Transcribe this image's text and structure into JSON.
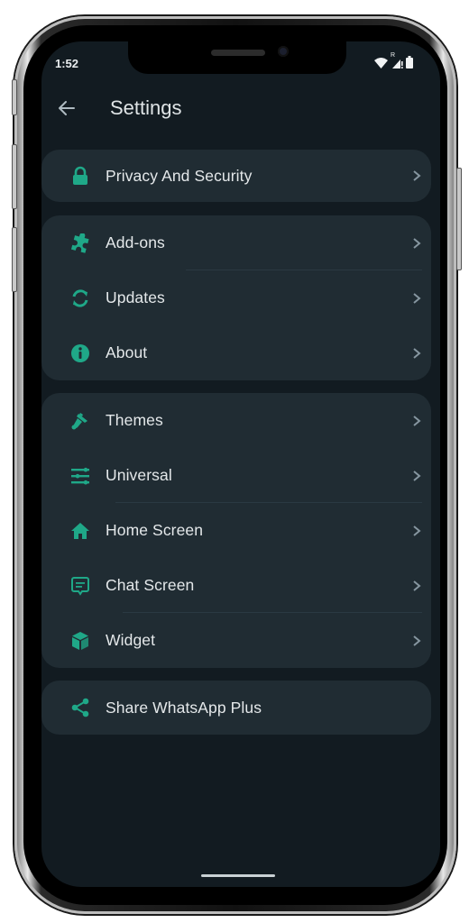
{
  "status_bar": {
    "time": "1:52",
    "icons": [
      "wifi-icon",
      "signal-roaming-icon",
      "battery-icon"
    ],
    "roaming_label": "R"
  },
  "app_bar": {
    "back_icon": "arrow-left-icon",
    "title": "Settings"
  },
  "accent_color": "#1fa888",
  "groups": [
    {
      "items": [
        {
          "label": "Privacy And Security",
          "icon": "lock-icon",
          "chevron": true
        }
      ]
    },
    {
      "items": [
        {
          "label": "Add-ons",
          "icon": "puzzle-icon",
          "chevron": true
        },
        {
          "label": "Updates",
          "icon": "sync-icon",
          "chevron": true
        },
        {
          "label": "About",
          "icon": "info-icon",
          "chevron": true
        }
      ]
    },
    {
      "items": [
        {
          "label": "Themes",
          "icon": "paint-brush-icon",
          "chevron": true
        },
        {
          "label": "Universal",
          "icon": "sliders-icon",
          "chevron": true
        },
        {
          "label": "Home Screen",
          "icon": "home-icon",
          "chevron": true
        },
        {
          "label": "Chat Screen",
          "icon": "chat-icon",
          "chevron": true
        },
        {
          "label": "Widget",
          "icon": "cube-icon",
          "chevron": true
        }
      ]
    },
    {
      "items": [
        {
          "label": "Share WhatsApp Plus",
          "icon": "share-icon",
          "chevron": false
        }
      ]
    }
  ]
}
